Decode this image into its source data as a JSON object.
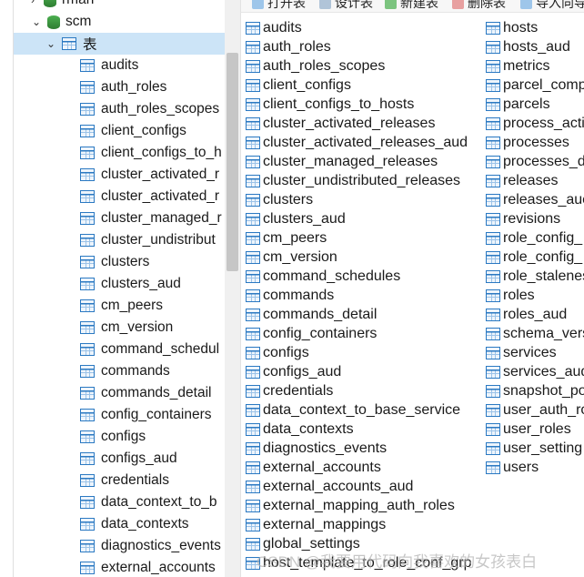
{
  "tree": {
    "db_partial": "rman",
    "db": "scm",
    "folder": "表",
    "tables": [
      "audits",
      "auth_roles",
      "auth_roles_scopes",
      "client_configs",
      "client_configs_to_h",
      "cluster_activated_r",
      "cluster_activated_r",
      "cluster_managed_r",
      "cluster_undistribut",
      "clusters",
      "clusters_aud",
      "cm_peers",
      "cm_version",
      "command_schedul",
      "commands",
      "commands_detail",
      "config_containers",
      "configs",
      "configs_aud",
      "credentials",
      "data_context_to_b",
      "data_contexts",
      "diagnostics_events",
      "external_accounts"
    ]
  },
  "toolbar": {
    "open": "打开表",
    "design": "设计表",
    "new": "新建表",
    "delete": "删除表",
    "import": "导入向导"
  },
  "objects": {
    "col1": [
      "audits",
      "auth_roles",
      "auth_roles_scopes",
      "client_configs",
      "client_configs_to_hosts",
      "cluster_activated_releases",
      "cluster_activated_releases_aud",
      "cluster_managed_releases",
      "cluster_undistributed_releases",
      "clusters",
      "clusters_aud",
      "cm_peers",
      "cm_version",
      "command_schedules",
      "commands",
      "commands_detail",
      "config_containers",
      "configs",
      "configs_aud",
      "credentials",
      "data_context_to_base_service",
      "data_contexts",
      "diagnostics_events",
      "external_accounts",
      "external_accounts_aud",
      "external_mapping_auth_roles",
      "external_mappings",
      "global_settings",
      "host_template_to_role_conf_grp"
    ],
    "col2": [
      "hosts",
      "hosts_aud",
      "metrics",
      "parcel_comp",
      "parcels",
      "process_acti",
      "processes",
      "processes_d",
      "releases",
      "releases_auc",
      "revisions",
      "role_config_",
      "role_config_",
      "role_stalenes",
      "roles",
      "roles_aud",
      "schema_vers",
      "services",
      "services_aud",
      "snapshot_po",
      "user_auth_ro",
      "user_roles",
      "user_setting",
      "users"
    ]
  },
  "watermark": "CSDN @我要用代码向我喜欢的女孩表白",
  "colors": {
    "selected": "#cce4f7",
    "table_icon": "#2b79c2",
    "db_icon": "#4caf50"
  }
}
